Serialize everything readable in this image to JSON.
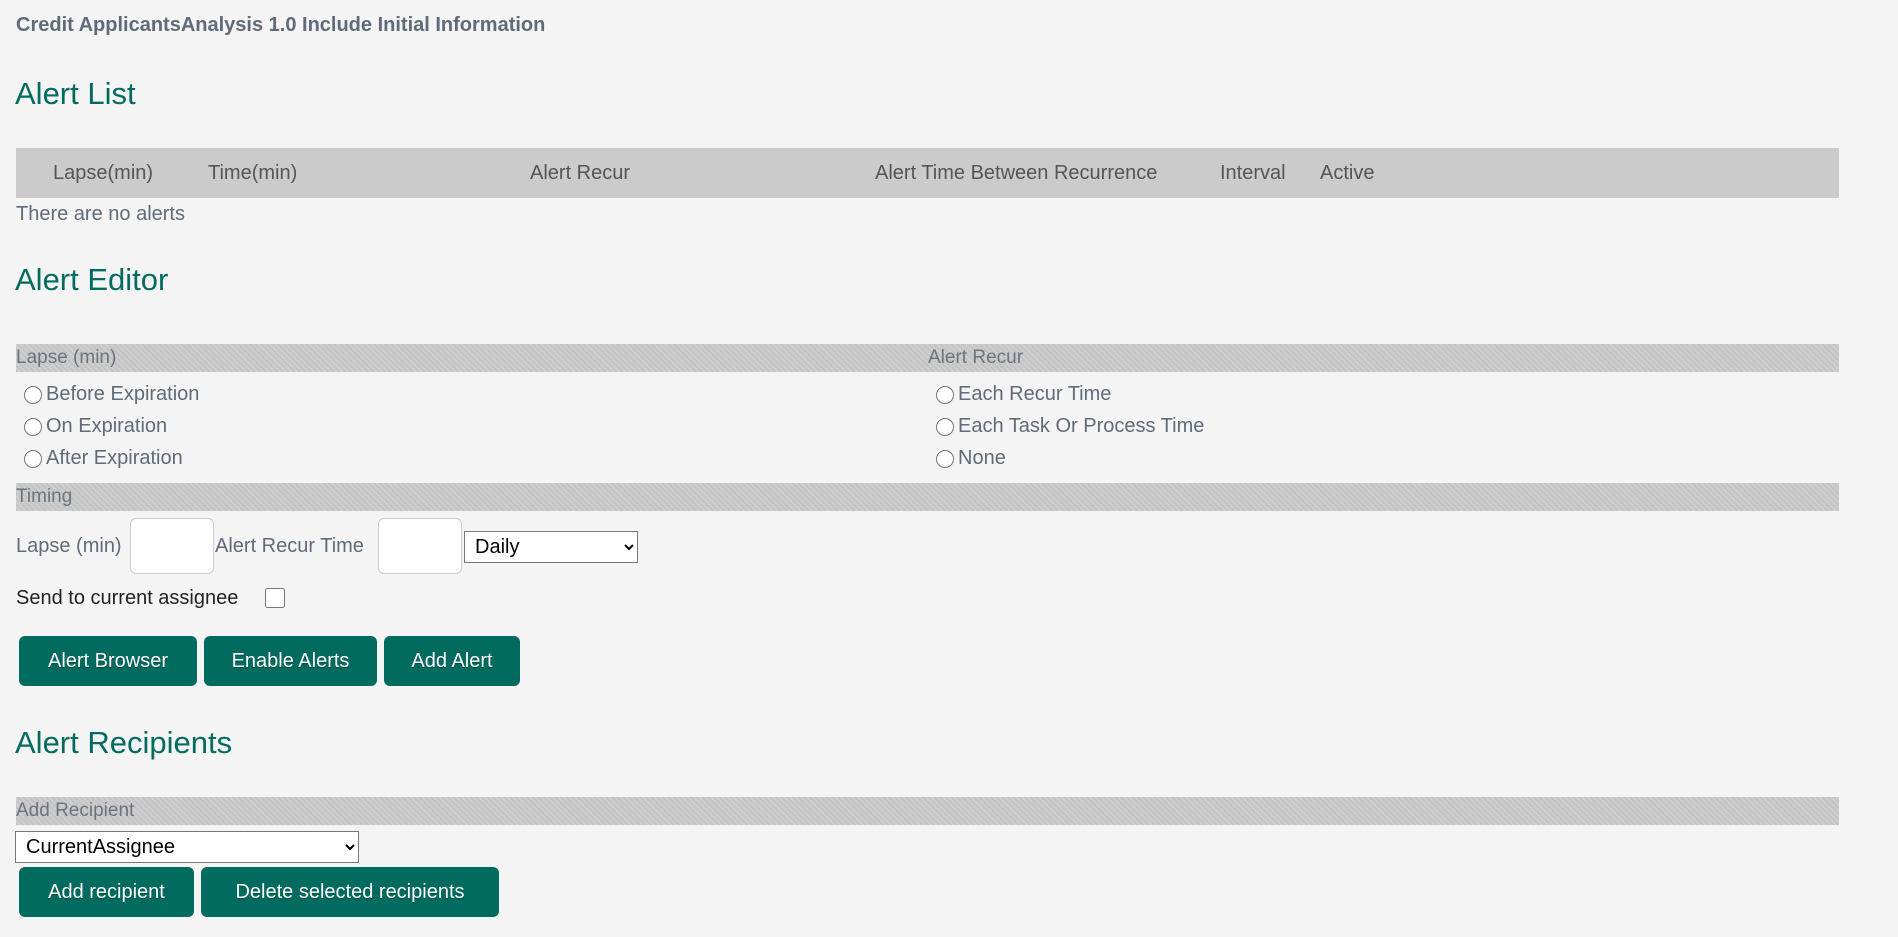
{
  "app_title": "Credit ApplicantsAnalysis 1.0 Include Initial Information",
  "alert_list": {
    "heading": "Alert List",
    "columns": [
      "Lapse(min)",
      "Time(min)",
      "Alert Recur",
      "Alert Time Between Recurrence",
      "Interval",
      "Active"
    ],
    "empty_text": "There are no alerts"
  },
  "alert_editor": {
    "heading": "Alert Editor",
    "lapse_section": "Lapse (min)",
    "lapse_options": [
      "Before Expiration",
      "On Expiration",
      "After Expiration"
    ],
    "recur_section": "Alert Recur",
    "recur_options": [
      "Each Recur Time",
      "Each Task Or Process Time",
      "None"
    ],
    "timing_section": "Timing",
    "lapse_label": "Lapse (min)",
    "lapse_value": "",
    "recur_time_label": "Alert Recur Time",
    "recur_time_value": "",
    "frequency_selected": "Daily",
    "send_to_assignee_label": "Send to current assignee",
    "send_to_assignee_checked": false,
    "buttons": [
      "Alert Browser",
      "Enable Alerts",
      "Add Alert"
    ]
  },
  "alert_recipients": {
    "heading": "Alert Recipients",
    "add_section": "Add Recipient",
    "recipient_selected": "CurrentAssignee",
    "buttons": [
      "Add recipient",
      "Delete selected recipients"
    ]
  },
  "colors": {
    "accent": "#006b5e",
    "background": "#f4f4f4",
    "header_bar": "#cbcbcb"
  }
}
